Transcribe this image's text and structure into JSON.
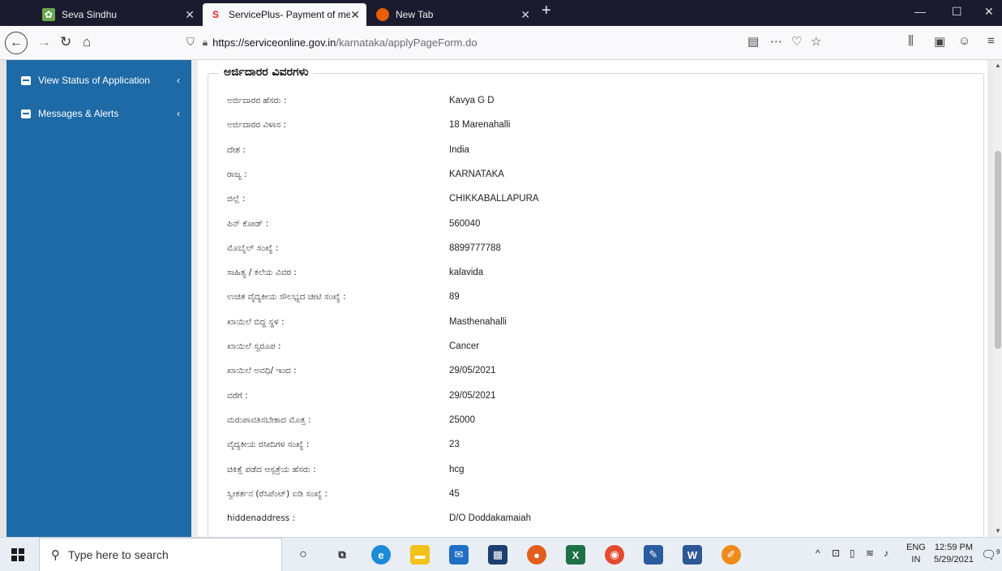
{
  "browser": {
    "tabs": [
      {
        "title": "Seva Sindhu",
        "active": false
      },
      {
        "title": "ServicePlus- Payment of medic",
        "active": true
      },
      {
        "title": "New Tab",
        "active": false
      }
    ],
    "url_host": "https://serviceonline.gov.in",
    "url_path": "/karnataka/applyPageForm.do"
  },
  "sidebar": {
    "items": [
      {
        "label": "View Status of Application"
      },
      {
        "label": "Messages & Alerts"
      }
    ]
  },
  "form": {
    "section_title": "ಅರ್ಜಿದಾರರ ವಿವರಗಳು",
    "rows": [
      {
        "label": "ಅರ್ಜಿದಾರರ ಹೆಸರು :",
        "value": "Kavya G D"
      },
      {
        "label": "ಅರ್ಜಿದಾರರ ವಿಳಾಸ :",
        "value": "18 Marenahalli"
      },
      {
        "label": "ದೇಶ :",
        "value": "India"
      },
      {
        "label": "ರಾಜ್ಯ :",
        "value": "KARNATAKA"
      },
      {
        "label": "ಜಿಲ್ಲೆ :",
        "value": "CHIKKABALLAPURA"
      },
      {
        "label": "ಪಿನ್ ಕೋಡ್ :",
        "value": "560040"
      },
      {
        "label": "ಮೊಬೈಲ್ ಸಂಖ್ಯೆ :",
        "value": "8899777788"
      },
      {
        "label": "ಸಾಹಿತ್ಯ / ಕಲೆಯ ವಿವರ :",
        "value": "kalavida"
      },
      {
        "label": "ಉಚಿತ ವೈದ್ಯಕೀಯ ಸೌಲಭ್ಯದ ಚೀಟಿ ಸಂಖ್ಯೆ :",
        "value": "89"
      },
      {
        "label": "ಖಾಯಿಲೆ ಬಿದ್ದ ಸ್ಥಳ :",
        "value": "Masthenahalli"
      },
      {
        "label": "ಖಾಯಿಲೆ ಸ್ವರೂಪ :",
        "value": "Cancer"
      },
      {
        "label": "ಖಾಯಿಲೆ ಅವಧಿ/ ಇಂದ :",
        "value": "29/05/2021"
      },
      {
        "label": "ವರೆಗೆ :",
        "value": "29/05/2021"
      },
      {
        "label": "ಮರುಪಾವತಿಸಬೇಕಾದ ಮೊತ್ತ :",
        "value": "25000"
      },
      {
        "label": "ವೈದ್ಯಕೀಯ ರಸೀದಿಗಳ ಸಂಖ್ಯೆ :",
        "value": "23"
      },
      {
        "label": "ಚಿಕಿತ್ಸೆ ಪಡೆದ ಆಸ್ಪತ್ರೆಯ ಹೆಸರು :",
        "value": "hcg"
      },
      {
        "label": "ಸ್ವೀಕರ್ತನ (ರೆಸಿಪೆಂಟ್) ಐಡಿ ಸಂಖ್ಯೆ :",
        "value": "45"
      },
      {
        "label": "hiddenaddress :",
        "value": "D/O Doddakamaiah"
      }
    ]
  },
  "taskbar": {
    "search_placeholder": "Type here to search",
    "lang_top": "ENG",
    "lang_bottom": "IN",
    "time": "12:59 PM",
    "date": "5/29/2021",
    "notification_count": "9"
  }
}
